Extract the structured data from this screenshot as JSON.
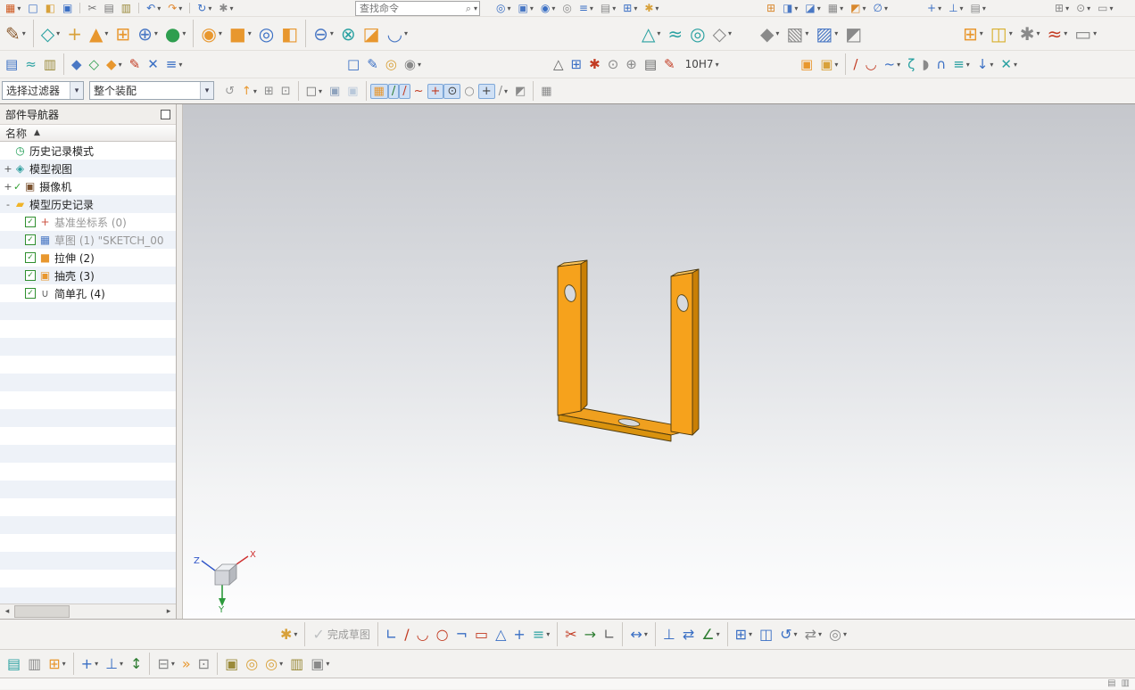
{
  "colors": {
    "model_face": "#f6a21c",
    "model_top": "#ffc65a",
    "model_side": "#c97f05",
    "viewport_top": "#c5c7cc",
    "viewport_bottom": "#fdfdfe",
    "axis_x": "#cf3030",
    "axis_y": "#2c9a3c",
    "axis_z": "#2f55c8"
  },
  "toolbar_row1": {
    "search_placeholder": "查找命令",
    "a": [
      {
        "n": "app-menu",
        "g": "▦",
        "c": "#cf5b22",
        "d": true
      },
      {
        "n": "new-file",
        "g": "□",
        "c": "#3a6fc4"
      },
      {
        "n": "open-file",
        "g": "◧",
        "c": "#d8a13a"
      },
      {
        "n": "save",
        "g": "▣",
        "c": "#3a6fc4"
      },
      {
        "sep": true
      },
      {
        "n": "cut",
        "g": "✂",
        "c": "#777777"
      },
      {
        "n": "copy",
        "g": "▤",
        "c": "#777777"
      },
      {
        "n": "paste",
        "g": "▥",
        "c": "#9a8a3a"
      },
      {
        "sep": true
      },
      {
        "n": "undo",
        "g": "↶",
        "c": "#3a6fc4",
        "d": true
      },
      {
        "n": "redo",
        "g": "↷",
        "c": "#e0862e",
        "d": true
      },
      {
        "sep": true
      },
      {
        "n": "repeat-command",
        "g": "↻",
        "c": "#3a6fc4",
        "d": true
      },
      {
        "n": "touch-mode",
        "g": "✱",
        "c": "#8a8a8a",
        "d": true
      }
    ],
    "b": [
      {
        "n": "command-finder",
        "g": "◎",
        "c": "#3a6fc4",
        "d": true
      },
      {
        "n": "window",
        "g": "▣",
        "c": "#4a78c4",
        "d": true
      },
      {
        "n": "show-hide",
        "g": "◉",
        "c": "#3a6fc4",
        "d": true
      },
      {
        "n": "immediate-hide",
        "g": "◎",
        "c": "#8a8a8a"
      },
      {
        "n": "layer-settings",
        "g": "≡",
        "c": "#3a6fc4",
        "d": true
      },
      {
        "n": "view-in-layer",
        "g": "▤",
        "c": "#8a8a8a",
        "d": true
      },
      {
        "n": "pattern-display",
        "g": "⊞",
        "c": "#3a6fc4",
        "d": true
      },
      {
        "n": "light-settings",
        "g": "✱",
        "c": "#d8a13a",
        "d": true
      }
    ],
    "c": [
      {
        "n": "assembly-add",
        "g": "⊞",
        "c": "#d8882e"
      },
      {
        "n": "move-face",
        "g": "◨",
        "c": "#4a78c4",
        "d": true
      },
      {
        "n": "edit-object-display",
        "g": "◪",
        "c": "#4a78c4",
        "d": true
      },
      {
        "n": "display-mode",
        "g": "▦",
        "c": "#8a8a8a",
        "d": true
      },
      {
        "n": "synchronous-modeling",
        "g": "◩",
        "c": "#d8882e",
        "d": true
      },
      {
        "n": "measure",
        "g": "∅",
        "c": "#3a6fc4",
        "d": true
      }
    ],
    "d": [
      {
        "n": "move-component",
        "g": "+",
        "c": "#3a6fc4",
        "d": true
      },
      {
        "n": "assembly-constraints",
        "g": "⊥",
        "c": "#3a6fc4",
        "d": true
      },
      {
        "n": "datum-display",
        "g": "▤",
        "c": "#8a8a8a",
        "d": true
      }
    ],
    "e": [
      {
        "n": "grid-settings",
        "g": "⊞",
        "c": "#8a8a8a",
        "d": true
      },
      {
        "n": "thread-tool",
        "g": "⊙",
        "c": "#8a8a8a",
        "d": true
      },
      {
        "n": "ruler",
        "g": "▭",
        "c": "#8a8a8a",
        "d": true
      }
    ]
  },
  "toolbar_row2": {
    "a": [
      {
        "n": "direct-sketch",
        "g": "✎",
        "c": "#8a5a2e",
        "d": true
      },
      {
        "sep": true
      },
      {
        "n": "datum-plane",
        "g": "◇",
        "c": "#2aa1a1",
        "d": true
      },
      {
        "n": "datum-csys",
        "g": "+",
        "c": "#d8a13a"
      },
      {
        "n": "extrude",
        "g": "▲",
        "c": "#e8972e",
        "d": true
      },
      {
        "n": "pattern-feature",
        "g": "⊞",
        "c": "#e8972e"
      },
      {
        "n": "unite",
        "g": "⊕",
        "c": "#4a78c4",
        "d": true
      },
      {
        "n": "point-set",
        "g": "●",
        "c": "#2e9e4f",
        "d": true
      },
      {
        "sep": true
      },
      {
        "n": "revolve",
        "g": "◉",
        "c": "#e8972e",
        "d": true
      },
      {
        "n": "block",
        "g": "■",
        "c": "#e8972e",
        "d": true
      },
      {
        "n": "hole",
        "g": "◎",
        "c": "#3a6fc4"
      },
      {
        "n": "rib",
        "g": "◧",
        "c": "#e8972e"
      },
      {
        "sep": true
      },
      {
        "n": "subtract",
        "g": "⊖",
        "c": "#4a78c4",
        "d": true
      },
      {
        "n": "intersect",
        "g": "⊗",
        "c": "#2aa1a1"
      },
      {
        "n": "trim-body",
        "g": "◪",
        "c": "#e8972e"
      },
      {
        "n": "edge-blend",
        "g": "◡",
        "c": "#4a78c4",
        "d": true
      }
    ],
    "b": [
      {
        "n": "detail-feature",
        "g": "△",
        "c": "#2aa1a1",
        "d": true
      },
      {
        "n": "swept",
        "g": "≈",
        "c": "#2aa1a1"
      },
      {
        "n": "tube",
        "g": "◎",
        "c": "#2aa1a1"
      },
      {
        "n": "surface-more",
        "g": "◇",
        "c": "#8a8a8a",
        "d": true
      }
    ],
    "c": [
      {
        "n": "sheet-surface",
        "g": "◆",
        "c": "#8a8a8a",
        "d": true
      },
      {
        "n": "patch-surface",
        "g": "▧",
        "c": "#8a8a8a",
        "d": true
      },
      {
        "n": "sew",
        "g": "▨",
        "c": "#4a78c4",
        "d": true
      },
      {
        "n": "thicken",
        "g": "◩",
        "c": "#8a8a8a"
      }
    ],
    "d": [
      {
        "n": "pattern-geometry",
        "g": "⊞",
        "c": "#e8972e",
        "d": true
      },
      {
        "n": "mirror-geometry",
        "g": "◫",
        "c": "#d8b02e",
        "d": true
      },
      {
        "n": "gear-toolbox",
        "g": "✱",
        "c": "#8a8a8a",
        "d": true
      },
      {
        "n": "spring-toolbox",
        "g": "≈",
        "c": "#c23b22",
        "d": true
      },
      {
        "n": "measure-ruler",
        "g": "▭",
        "c": "#8a8a8a",
        "d": true
      }
    ]
  },
  "toolbar_row3": {
    "a": [
      {
        "n": "layer-stack",
        "g": "▤",
        "c": "#3a6fc4"
      },
      {
        "n": "expressions",
        "g": "≈",
        "c": "#2aa1a1"
      },
      {
        "n": "information",
        "g": "▥",
        "c": "#9a8a3a"
      },
      {
        "sep": true
      },
      {
        "n": "wave-linker",
        "g": "◆",
        "c": "#4a78c4"
      },
      {
        "n": "interpart-link",
        "g": "◇",
        "c": "#2e9e4f"
      },
      {
        "n": "update-session",
        "g": "◆",
        "c": "#e8972e",
        "d": true
      },
      {
        "n": "edit-formula",
        "g": "✎",
        "c": "#c23b22"
      },
      {
        "n": "annotate",
        "g": "✕",
        "c": "#3a6fc4"
      },
      {
        "n": "sort-list",
        "g": "≡",
        "c": "#3a6fc4",
        "d": true
      }
    ],
    "b": [
      {
        "n": "sheet",
        "g": "□",
        "c": "#3a6fc4"
      },
      {
        "n": "pen-tool",
        "g": "✎",
        "c": "#3a6fc4"
      },
      {
        "n": "thread-ring",
        "g": "◎",
        "c": "#d8a13a"
      },
      {
        "n": "target-point",
        "g": "◉",
        "c": "#8a8a8a",
        "d": true
      }
    ],
    "c": [
      {
        "n": "triangle-annotation",
        "g": "△",
        "c": "#666666"
      },
      {
        "n": "grid-table",
        "g": "⊞",
        "c": "#3a6fc4"
      },
      {
        "n": "star-pattern",
        "g": "✱",
        "c": "#c23b22"
      },
      {
        "n": "bolt-circle",
        "g": "⊙",
        "c": "#8a8a8a"
      },
      {
        "n": "center-mark",
        "g": "⊕",
        "c": "#8a8a8a"
      },
      {
        "n": "table-annotation",
        "g": "▤",
        "c": "#666666"
      },
      {
        "n": "dimension-edit",
        "g": "✎",
        "c": "#c23b22"
      },
      {
        "n": "tolerance",
        "label": "10H7",
        "d": true
      }
    ],
    "d": [
      {
        "n": "assembly-pair",
        "g": "▣",
        "c": "#e8972e"
      },
      {
        "n": "component-set",
        "g": "▣",
        "c": "#d8a13a",
        "d": true
      },
      {
        "sep": true
      },
      {
        "n": "line-curve",
        "g": "/",
        "c": "#c23b22"
      },
      {
        "n": "arc-curve",
        "g": "◡",
        "c": "#c23b22"
      },
      {
        "n": "spline",
        "g": "~",
        "c": "#3a6fc4",
        "d": true
      },
      {
        "n": "helix",
        "g": "ζ",
        "c": "#2aa1a1"
      },
      {
        "n": "patch-curve",
        "g": "◗",
        "c": "#8a8a8a"
      },
      {
        "n": "bridge-curve",
        "g": "∩",
        "c": "#3a6fc4"
      },
      {
        "n": "offset-curve-3d",
        "g": "≡",
        "c": "#2aa1a1",
        "d": true
      },
      {
        "n": "project-curve",
        "g": "↓",
        "c": "#3a6fc4",
        "d": true
      },
      {
        "n": "intersect-curve",
        "g": "✕",
        "c": "#2aa1a1",
        "d": true
      }
    ]
  },
  "selection_bar": {
    "filter_value": "选择过滤器",
    "scope_value": "整个装配",
    "icons": [
      {
        "n": "filter-reset",
        "g": "↺",
        "c": "#999999"
      },
      {
        "n": "up-one-level",
        "g": "↑",
        "c": "#e8972e",
        "d": true
      },
      {
        "n": "interpart-select",
        "g": "⊞",
        "c": "#8a8a8a"
      },
      {
        "n": "group-select",
        "g": "⊡",
        "c": "#8a8a8a"
      },
      {
        "sep": true
      },
      {
        "n": "marquee-style",
        "g": "□",
        "c": "#666666",
        "d": true
      },
      {
        "n": "highlight-body",
        "g": "▣",
        "c": "#8fa3bd"
      },
      {
        "n": "shaded-body",
        "g": "▣",
        "c": "#b9c8da"
      },
      {
        "sep": true
      },
      {
        "n": "enable-snap-point",
        "g": "▦",
        "c": "#e8972e",
        "a": true
      },
      {
        "n": "snap-endpoint",
        "g": "/",
        "c": "#2e7d32",
        "a": true
      },
      {
        "n": "snap-midpoint",
        "g": "/",
        "c": "#c23b22",
        "a": true
      },
      {
        "n": "snap-control-point",
        "g": "~",
        "c": "#c23b22"
      },
      {
        "n": "snap-intersection",
        "g": "+",
        "c": "#c23b22",
        "a": true
      },
      {
        "n": "snap-arc-center",
        "g": "⊙",
        "c": "#444444",
        "a": true
      },
      {
        "n": "snap-quadrant",
        "g": "○",
        "c": "#8a8a8a"
      },
      {
        "n": "snap-existing-point",
        "g": "+",
        "c": "#444444",
        "a": true
      },
      {
        "n": "snap-point-on-curve",
        "g": "/",
        "c": "#8a8a8a",
        "d": true
      },
      {
        "n": "snap-point-on-face",
        "g": "◩",
        "c": "#8a8a8a"
      },
      {
        "sep": true
      },
      {
        "n": "shortcut-toolbar",
        "g": "▦",
        "c": "#8a8a8a"
      }
    ]
  },
  "navigator": {
    "title": "部件导航器",
    "column": "名称",
    "sort_glyph": "▲",
    "items": [
      {
        "n": "history-mode",
        "label": "历史记录模式",
        "g": "◷",
        "c": "#1f9d55",
        "indent": 0,
        "expand": ""
      },
      {
        "n": "model-views",
        "label": "模型视图",
        "g": "◈",
        "c": "#2e9e9e",
        "indent": 0,
        "expand": "+"
      },
      {
        "n": "cameras",
        "label": "摄像机",
        "g": "▣",
        "c": "#7a5230",
        "indent": 0,
        "expand": "+",
        "precheck": true
      },
      {
        "n": "model-history",
        "label": "模型历史记录",
        "g": "▰",
        "c": "#f0b429",
        "indent": 0,
        "expand": "-"
      },
      {
        "n": "datum-csys",
        "label": "基准坐标系 (0)",
        "g": "+",
        "c": "#cc5544",
        "indent": 1,
        "checkbox": true,
        "dim": true
      },
      {
        "n": "sketch",
        "label": "草图 (1) \"SKETCH_00",
        "g": "▦",
        "c": "#4a78c4",
        "indent": 1,
        "checkbox": true,
        "dim": true
      },
      {
        "n": "extrude",
        "label": "拉伸 (2)",
        "g": "■",
        "c": "#e8972e",
        "indent": 1,
        "checkbox": true
      },
      {
        "n": "shell",
        "label": "抽壳 (3)",
        "g": "▣",
        "c": "#e8972e",
        "indent": 1,
        "checkbox": true
      },
      {
        "n": "simple-hole",
        "label": "简单孔 (4)",
        "g": "∪",
        "c": "#666666",
        "indent": 1,
        "checkbox": true
      }
    ]
  },
  "viewport": {
    "triad": {
      "x": "X",
      "y": "Y",
      "z": "Z"
    }
  },
  "sketch_bar": {
    "items": [
      {
        "n": "orient-to-sketch",
        "g": "✱",
        "c": "#d8a13a",
        "d": true
      },
      {
        "sep": true
      },
      {
        "n": "finish-sketch",
        "g": "✓",
        "c": "#8a9096",
        "label": "完成草图",
        "disabled": true
      },
      {
        "sep": true
      },
      {
        "n": "profile",
        "g": "∟",
        "c": "#3a6fc4"
      },
      {
        "n": "line",
        "g": "/",
        "c": "#c23b22"
      },
      {
        "n": "arc",
        "g": "◡",
        "c": "#c23b22"
      },
      {
        "n": "circle",
        "g": "○",
        "c": "#c23b22"
      },
      {
        "n": "fillet",
        "g": "¬",
        "c": "#3a6fc4"
      },
      {
        "n": "rectangle",
        "g": "▭",
        "c": "#c23b22"
      },
      {
        "n": "polygon",
        "g": "△",
        "c": "#3a6fc4"
      },
      {
        "n": "point",
        "g": "+",
        "c": "#3a6fc4"
      },
      {
        "n": "offset-curve",
        "g": "≡",
        "c": "#2aa1a1",
        "d": true
      },
      {
        "sep": true
      },
      {
        "n": "quick-trim",
        "g": "✂",
        "c": "#c23b22"
      },
      {
        "n": "quick-extend",
        "g": "→",
        "c": "#2e7d32"
      },
      {
        "n": "make-corner",
        "g": "∟",
        "c": "#666666"
      },
      {
        "sep": true
      },
      {
        "n": "rapid-dimension",
        "g": "↔",
        "c": "#3a6fc4",
        "d": true
      },
      {
        "sep": true
      },
      {
        "n": "geometric-constraints",
        "g": "⊥",
        "c": "#3a6fc4"
      },
      {
        "n": "make-symmetric",
        "g": "⇄",
        "c": "#3a6fc4"
      },
      {
        "n": "display-constraints",
        "g": "∠",
        "c": "#2e7d32",
        "d": true
      },
      {
        "sep": true
      },
      {
        "n": "pattern-curve",
        "g": "⊞",
        "c": "#3a6fc4",
        "d": true
      },
      {
        "n": "mirror-curve",
        "g": "◫",
        "c": "#3a6fc4"
      },
      {
        "n": "alternate-solution",
        "g": "↺",
        "c": "#3a6fc4",
        "d": true
      },
      {
        "n": "convert-reference",
        "g": "⇄",
        "c": "#8a8a8a",
        "d": true
      },
      {
        "n": "relations-browser",
        "g": "◎",
        "c": "#8a8a8a",
        "d": true
      }
    ]
  },
  "assembly_bar": {
    "items": [
      {
        "n": "component-stack",
        "g": "▤",
        "c": "#2aa1a1"
      },
      {
        "n": "exploded-views",
        "g": "▥",
        "c": "#8a8a8a"
      },
      {
        "n": "add-component",
        "g": "⊞",
        "c": "#e8972e",
        "d": true
      },
      {
        "sep": true
      },
      {
        "n": "move-component",
        "g": "+",
        "c": "#3a6fc4",
        "d": true
      },
      {
        "n": "assembly-constraints",
        "g": "⊥",
        "c": "#3a6fc4",
        "d": true
      },
      {
        "n": "show-degrees-of-freedom",
        "g": "↕",
        "c": "#2e7d32"
      },
      {
        "sep": true
      },
      {
        "n": "arrangements",
        "g": "⊟",
        "c": "#8a8a8a",
        "d": true
      },
      {
        "n": "sequence",
        "g": "»",
        "c": "#e8972e"
      },
      {
        "n": "substitute-component",
        "g": "⊡",
        "c": "#8a8a8a"
      },
      {
        "sep": true
      },
      {
        "n": "wave-geometry-linker",
        "g": "▣",
        "c": "#9a8a3a"
      },
      {
        "n": "interpart-copy",
        "g": "◎",
        "c": "#d8a13a"
      },
      {
        "n": "wave-interface",
        "g": "◎",
        "c": "#d8a13a",
        "d": true
      },
      {
        "n": "product-interface",
        "g": "▥",
        "c": "#9a8a3a"
      },
      {
        "n": "structure-cube",
        "g": "▣",
        "c": "#8a8a8a",
        "d": true
      }
    ]
  },
  "statusbar": {
    "items": [
      {
        "n": "status-alerts",
        "g": "▤",
        "c": "#8a8a8a"
      },
      {
        "n": "status-panel",
        "g": "▥",
        "c": "#8a8a8a"
      }
    ]
  }
}
